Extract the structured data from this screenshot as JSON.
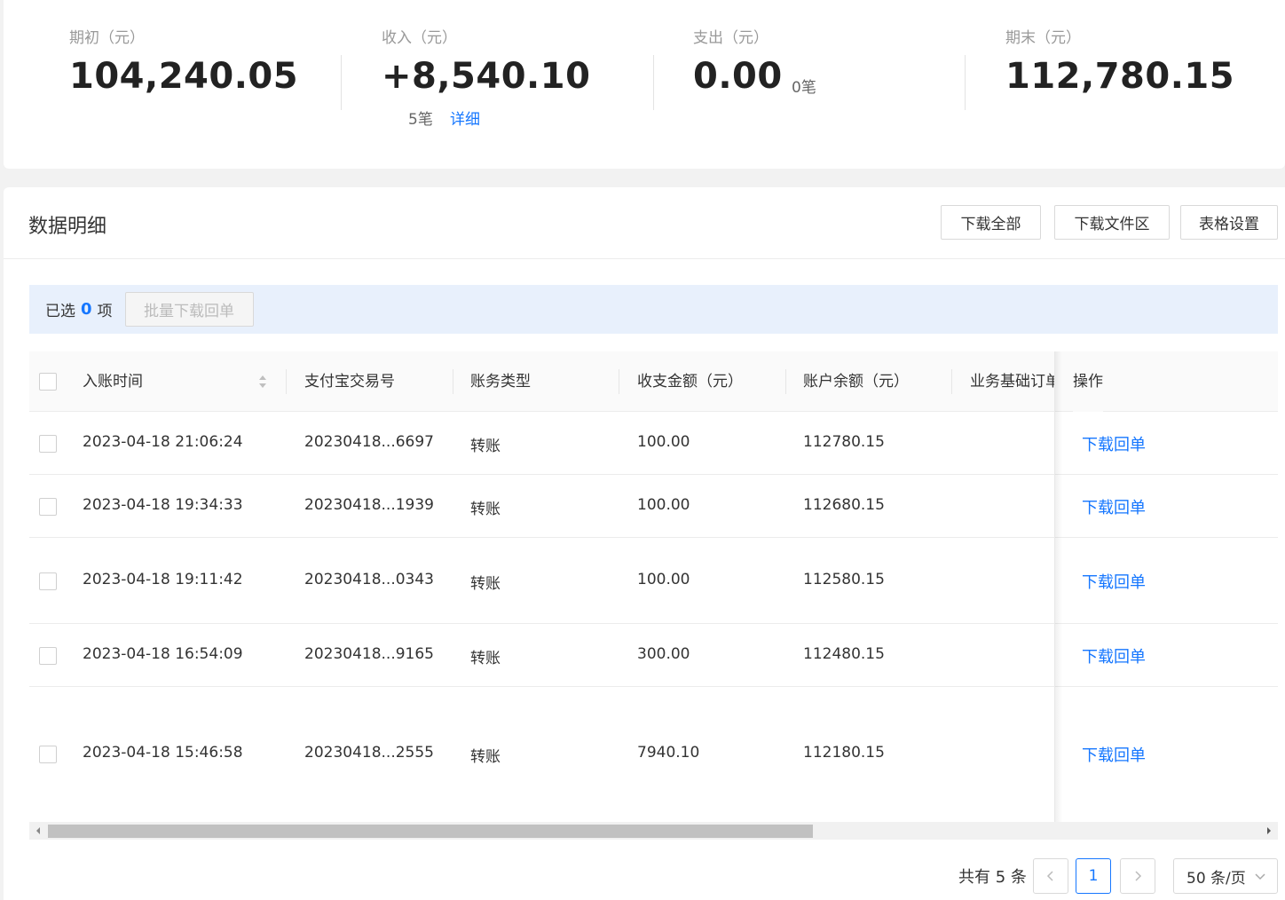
{
  "summary": [
    {
      "label": "期初（元）",
      "value": "104,240.05"
    },
    {
      "label": "收入（元）",
      "value": "+8,540.10",
      "count": "5笔",
      "link": "详细"
    },
    {
      "label": "支出（元）",
      "value": "0.00",
      "count": "0笔"
    },
    {
      "label": "期末（元）",
      "value": "112,780.15"
    }
  ],
  "detail": {
    "title": "数据明细",
    "buttons": [
      "下载全部",
      "下载文件区",
      "表格设置"
    ],
    "selection": {
      "prefix": "已选",
      "count": "0",
      "suffix": "项",
      "batch_button": "批量下载回单"
    }
  },
  "table": {
    "columns": [
      "入账时间",
      "支付宝交易号",
      "账务类型",
      "收支金额（元）",
      "账户余额（元）",
      "业务基础订单号",
      "操作"
    ],
    "rows": [
      {
        "time": "2023-04-18 21:06:24",
        "trade_no": "20230418...6697",
        "type": "转账",
        "amount": "100.00",
        "balance": "112780.15",
        "action": "下载回单"
      },
      {
        "time": "2023-04-18 19:34:33",
        "trade_no": "20230418...1939",
        "type": "转账",
        "amount": "100.00",
        "balance": "112680.15",
        "action": "下载回单"
      },
      {
        "time": "2023-04-18 19:11:42",
        "trade_no": "20230418...0343",
        "type": "转账",
        "amount": "100.00",
        "balance": "112580.15",
        "action": "下载回单"
      },
      {
        "time": "2023-04-18 16:54:09",
        "trade_no": "20230418...9165",
        "type": "转账",
        "amount": "300.00",
        "balance": "112480.15",
        "action": "下载回单"
      },
      {
        "time": "2023-04-18 15:46:58",
        "trade_no": "20230418...2555",
        "type": "转账",
        "amount": "7940.10",
        "balance": "112180.15",
        "action": "下载回单"
      }
    ]
  },
  "pagination": {
    "total_text": "共有 5 条",
    "current_page": "1",
    "page_size": "50 条/页"
  },
  "colors": {
    "accent": "#1677ff",
    "selection_bg": "#e8f0fc"
  }
}
